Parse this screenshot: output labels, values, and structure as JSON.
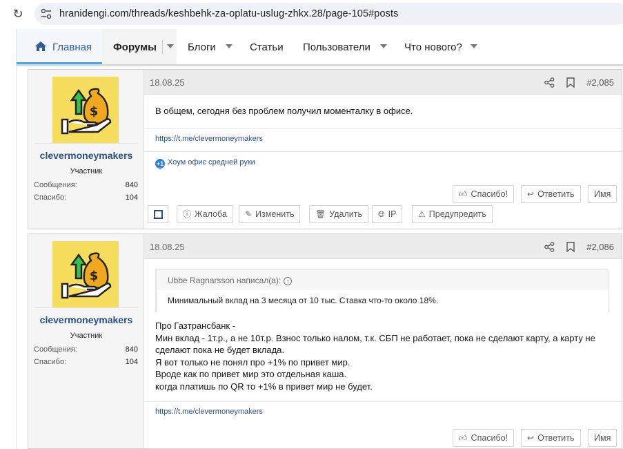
{
  "browser": {
    "url": "hranidengi.com/threads/keshbehk-za-oplatu-uslug-zhkx.28/page-105#posts"
  },
  "nav": {
    "home": "Главная",
    "forums": "Форумы",
    "blogs": "Блоги",
    "articles": "Статьи",
    "users": "Пользователи",
    "whats_new": "Что нового?"
  },
  "posts": [
    {
      "user": {
        "name": "clevermoneymakers",
        "title": "Участник",
        "stats": [
          {
            "label": "Сообщения:",
            "value": "840"
          },
          {
            "label": "Спасибо:",
            "value": "104"
          }
        ]
      },
      "date": "18.08.25",
      "number": "#2,085",
      "message": "В общем, сегодня без проблем получил моменталку в офисе.",
      "signature": "https://t.me/clevermoneymakers",
      "reaction": {
        "badge": "+1",
        "text": "Хоум офис средней руки"
      },
      "buttons": {
        "thanks": "Спасибо!",
        "reply": "Ответить",
        "name": "Имя",
        "report": "Жалоба",
        "edit": "Изменить",
        "delete": "Удалить",
        "ip": "IP",
        "warn": "Предупредить"
      }
    },
    {
      "user": {
        "name": "clevermoneymakers",
        "title": "Участник",
        "stats": [
          {
            "label": "Сообщения:",
            "value": "840"
          },
          {
            "label": "Спасибо:",
            "value": "104"
          }
        ]
      },
      "date": "18.08.25",
      "number": "#2,086",
      "quote": {
        "author": "Ubbe Ragnarsson написал(а):",
        "text": "Минимальный вклад на 3 месяца от 10 тыс. Ставка что-то около 18%."
      },
      "message_lines": [
        "Про Газтрансбанк -",
        "Мин вклад - 1т.р., а не 10т.р. Взнос только налом, т.к. СБП не работает, пока не сделают карту, а карту не",
        "сделают пока не будет вклада.",
        "Я вот только не понял про +1% по привет мир.",
        "Вроде как по привет мир это отдельная каша.",
        "когда платишь по QR то +1% в привет мир не будет."
      ],
      "signature": "https://t.me/clevermoneymakers",
      "buttons": {
        "thanks": "Спасибо!",
        "reply": "Ответить",
        "name": "Имя"
      }
    }
  ]
}
